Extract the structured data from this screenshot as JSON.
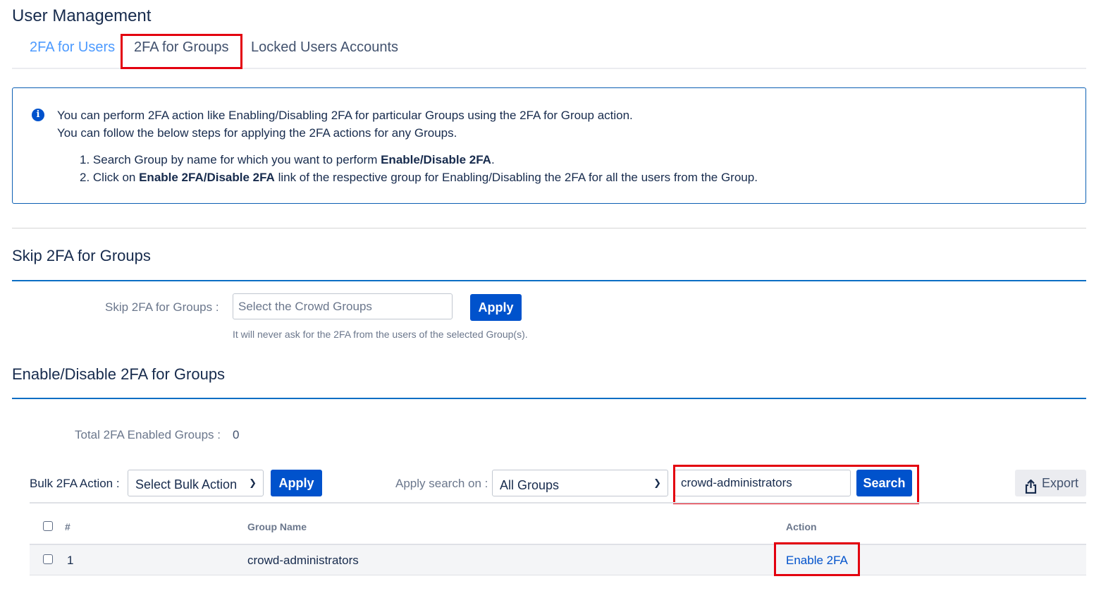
{
  "page": {
    "title": "User Management"
  },
  "tabs": [
    {
      "label": "2FA for Users",
      "active": false
    },
    {
      "label": "2FA for Groups",
      "active": true
    },
    {
      "label": "Locked Users Accounts",
      "active": false
    }
  ],
  "info": {
    "icon": "info-icon",
    "line1": "You can perform 2FA action like Enabling/Disabling 2FA for particular Groups using the 2FA for Group action.",
    "line2": "You can follow the below steps for applying the 2FA actions for any Groups.",
    "step1_prefix": "1. Search Group by name for which you want to perform ",
    "step1_bold": "Enable/Disable 2FA",
    "step1_suffix": ".",
    "step2_prefix": "2. Click on ",
    "step2_bold": "Enable 2FA/Disable 2FA",
    "step2_suffix": " link of the respective group for Enabling/Disabling the 2FA for all the users from the Group."
  },
  "skip_section": {
    "title": "Skip 2FA for Groups",
    "label": "Skip 2FA for Groups :",
    "input_placeholder": "Select the Crowd Groups",
    "apply_label": "Apply",
    "help_text": "It will never ask for the 2FA from the users of the selected Group(s)."
  },
  "enable_section": {
    "title": "Enable/Disable 2FA for Groups",
    "total_label": "Total 2FA Enabled Groups :",
    "total_value": "0"
  },
  "toolbar": {
    "bulk_label": "Bulk 2FA Action :",
    "bulk_select_value": "Select Bulk Action",
    "bulk_apply_label": "Apply",
    "search_on_label": "Apply search on :",
    "search_on_value": "All Groups",
    "search_value": "crowd-administrators",
    "search_button": "Search",
    "export_label": "Export",
    "export_icon": "share-export-icon"
  },
  "table": {
    "columns": [
      "#",
      "Group Name",
      "Action"
    ],
    "rows": [
      {
        "num": "1",
        "group_name": "crowd-administrators",
        "action": "Enable 2FA",
        "checked": false
      }
    ]
  },
  "colors": {
    "primary": "#0052cc",
    "highlight": "#e3000f",
    "section_rule": "#0b6ec4",
    "link_tab": "#4c9aff"
  }
}
